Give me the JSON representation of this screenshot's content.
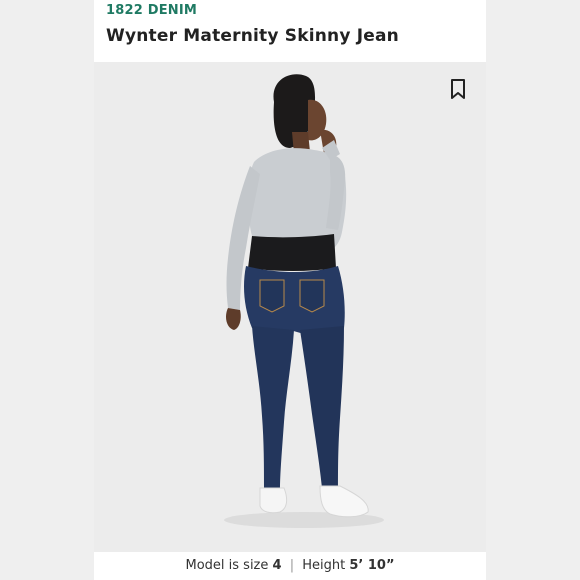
{
  "listing": {
    "brand": "1822 DENIM",
    "title": "Wynter Maternity Skinny Jean"
  },
  "caption": {
    "size_label": "Model is size",
    "size_value": "4",
    "separator": "|",
    "height_label": "Height",
    "height_value": "5’ 10”"
  },
  "icons": {
    "bookmark": "bookmark-icon"
  },
  "colors": {
    "brand": "#1f7a63",
    "title": "#222222",
    "photo_background": "#ececec"
  }
}
